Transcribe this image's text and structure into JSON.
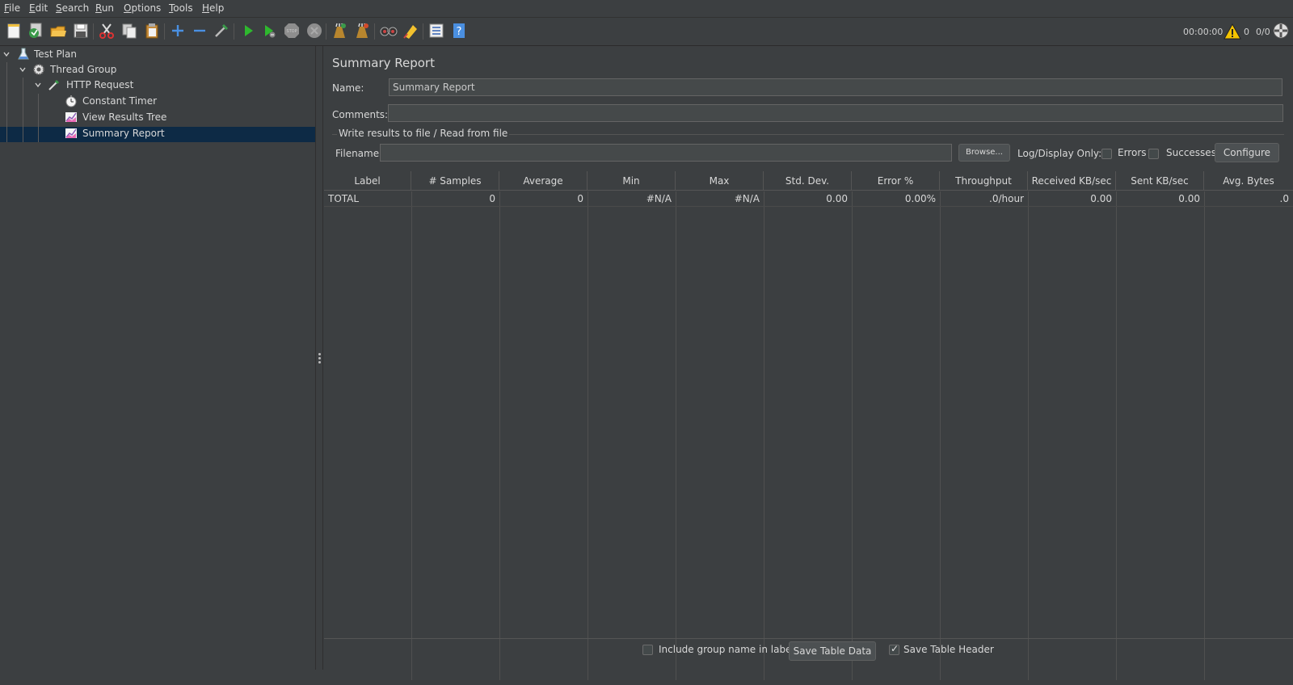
{
  "menu": {
    "file": {
      "mn": "F",
      "rest": "ile"
    },
    "edit": {
      "mn": "E",
      "rest": "dit"
    },
    "search": {
      "mn": "S",
      "rest": "earch"
    },
    "run": {
      "mn": "R",
      "rest": "un"
    },
    "options": {
      "mn": "O",
      "rest": "ptions"
    },
    "tools": {
      "mn": "T",
      "rest": "ools"
    },
    "help": {
      "mn": "H",
      "rest": "elp"
    }
  },
  "toolbar": {
    "icons": [
      "new-icon",
      "templates-icon",
      "open-icon",
      "save-icon",
      "cut-icon",
      "copy-icon",
      "paste-icon",
      "expand-icon",
      "collapse-icon",
      "toggle-icon",
      "start-icon",
      "start-no-pauses-icon",
      "stop-icon",
      "shutdown-icon",
      "clear-icon",
      "clear-all-icon",
      "search-icon",
      "reset-search-icon",
      "function-helper-icon",
      "help-icon"
    ],
    "elapsed_time": "00:00:00",
    "warning_count": "0",
    "active_threads": "0/0"
  },
  "tree": {
    "nodes": [
      {
        "label": "Test Plan",
        "icon": "flask-icon"
      },
      {
        "label": "Thread Group",
        "icon": "gear-icon"
      },
      {
        "label": "HTTP Request",
        "icon": "pipette-icon"
      },
      {
        "label": "Constant Timer",
        "icon": "stopwatch-icon"
      },
      {
        "label": "View Results Tree",
        "icon": "graph-icon"
      },
      {
        "label": "Summary Report",
        "icon": "graph-icon"
      }
    ],
    "selected": "Summary Report"
  },
  "panel": {
    "title": "Summary Report",
    "name_label": "Name:",
    "name_value": "Summary Report",
    "comments_label": "Comments:",
    "comments_value": "",
    "file_section_label": "Write results to file / Read from file",
    "filename_label": "Filename",
    "filename_value": "",
    "browse_label": "Browse...",
    "log_display_label": "Log/Display Only:",
    "errors_label": "Errors",
    "errors_checked": false,
    "successes_label": "Successes",
    "successes_checked": false,
    "configure_label": "Configure"
  },
  "table": {
    "headers": [
      "Label",
      "# Samples",
      "Average",
      "Min",
      "Max",
      "Std. Dev.",
      "Error %",
      "Throughput",
      "Received KB/sec",
      "Sent KB/sec",
      "Avg. Bytes"
    ],
    "rows": [
      [
        "TOTAL",
        "0",
        "0",
        "#N/A",
        "#N/A",
        "0.00",
        "0.00%",
        ".0/hour",
        "0.00",
        "0.00",
        ".0"
      ]
    ]
  },
  "bottom": {
    "include_group_label": "Include group name in label?",
    "include_group_checked": false,
    "save_table_data_label": "Save Table Data",
    "save_table_header_label": "Save Table Header",
    "save_table_header_checked": true
  }
}
